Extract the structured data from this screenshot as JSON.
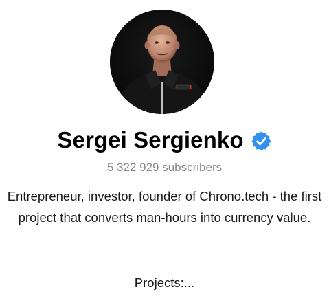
{
  "profile": {
    "name": "Sergei Sergienko",
    "subscribers": "5 322 929 subscribers",
    "bio": "Entrepreneur, investor, founder of Chrono.tech - the first project that converts man-hours into currency value.",
    "projects": "Projects:..."
  },
  "icons": {
    "verified": "verified-badge-icon",
    "avatar": "profile-photo"
  },
  "colors": {
    "verified_badge": "#3390ec",
    "subscribers_text": "#8a8a8a",
    "avatar_background": "#0a0a0a"
  }
}
